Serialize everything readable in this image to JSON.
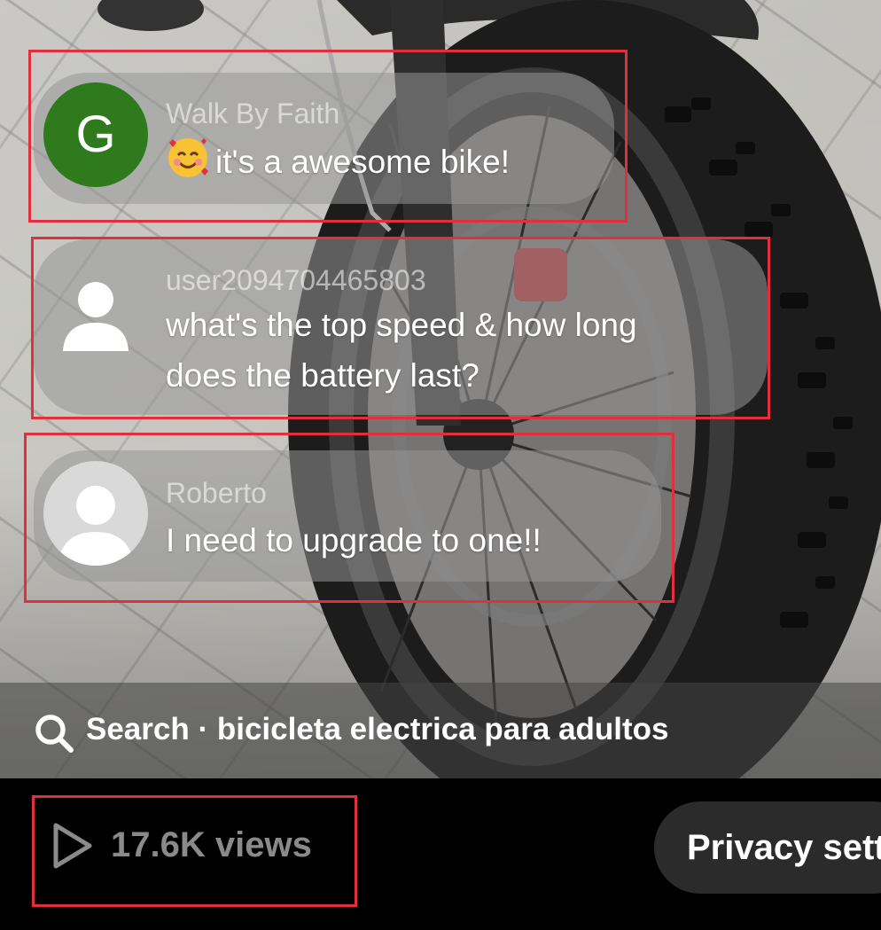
{
  "comments": [
    {
      "username": "Walk By Faith",
      "avatar_letter": "G",
      "avatar_color": "#2f7a1c",
      "emoji": "smiling-face-with-hearts",
      "text": "it's a awesome bike!"
    },
    {
      "username": "user2094704465803",
      "avatar": "default-person-icon",
      "text_line1": "what's the top speed & how long",
      "text_line2": "does the battery last?"
    },
    {
      "username": "Roberto",
      "avatar": "default-person-icon",
      "text": "I need to upgrade to one!!"
    }
  ],
  "search": {
    "label": "Search · bicicleta electrica para adultos"
  },
  "footer": {
    "views": "17.6K views",
    "privacy_button": "Privacy settings"
  },
  "colors": {
    "highlight": "#e0303e",
    "bubble": "rgba(150,150,150,0.55)",
    "bottom_bar": "#000000",
    "pill": "#2b2b2b"
  }
}
